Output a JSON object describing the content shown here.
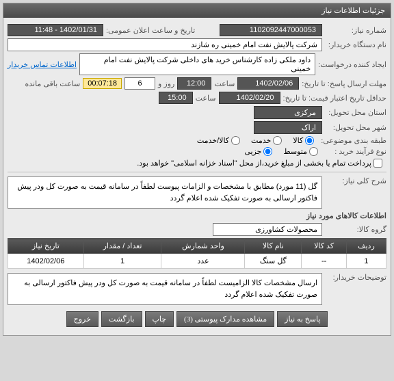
{
  "header": {
    "title": "جزئیات اطلاعات نیاز"
  },
  "info": {
    "need_no_label": "شماره نیاز:",
    "need_no": "1102092447000053",
    "announce_label": "تاریخ و ساعت اعلان عمومی:",
    "announce": "1402/01/31 - 11:48",
    "org_label": "نام دستگاه خریدار:",
    "org": "شرکت پالایش نفت امام خمینی  ره  شازند",
    "creator_label": "ایجاد کننده درخواست:",
    "creator": "داود  ملکی زاده کارشناس خرید های داخلی  شرکت پالایش نفت امام خمینی",
    "contact": "اطلاعات تماس خریدار",
    "deadline_label": "مهلت ارسال پاسخ: تا تاریخ:",
    "deadline_date": "1402/02/06",
    "hour_lbl": "ساعت",
    "deadline_hour": "12:00",
    "day_lbl": "روز و",
    "days": "6",
    "countdown": "00:07:18",
    "remain": "ساعت باقی مانده",
    "valid_label": "حداقل تاریخ اعتبار قیمت: تا تاریخ:",
    "valid_date": "1402/02/20",
    "valid_hour": "15:00",
    "province_label": "استان محل تحویل:",
    "province": "مرکزی",
    "city_label": "شهر محل تحویل:",
    "city": "اراک",
    "topic_label": "طبقه بندی موضوعی:",
    "t_goods": "کالا",
    "t_service": "خدمت",
    "t_goodsservice": "کالا/خدمت",
    "proc_label": "نوع فرآیند خرید :",
    "p_medium": "متوسط",
    "p_partial": "جزیی",
    "p_note": "پرداخت تمام یا بخشی از مبلغ خرید،از محل \"اسناد خزانه اسلامی\" خواهد بود."
  },
  "desc": {
    "label": "شرح کلی نیاز:",
    "text": "گل (11 مورد) مطابق با مشخصات و الزامات پیوست لطفاً در سامانه قیمت به صورت کل ودر پیش فاکتور ارسالی به صورت تفکیک شده اعلام گردد"
  },
  "goods_header": "اطلاعات کالاهای مورد نیاز",
  "group_label": "گروه کالا:",
  "group": "محصولات کشاورزی",
  "table": {
    "cols": [
      "ردیف",
      "کد کالا",
      "نام کالا",
      "واحد شمارش",
      "تعداد / مقدار",
      "تاریخ نیاز"
    ],
    "row": {
      "idx": "1",
      "code": "--",
      "name": "گل سنگ",
      "unit": "عدد",
      "qty": "1",
      "date": "1402/02/06"
    }
  },
  "buyer_note": {
    "label": "توضیحات خریدار:",
    "text": "ارسال مشخصات کالا الزامیست لطفاً در سامانه قیمت به صورت کل ودر پیش فاکتور ارسالی به صورت تفکیک شده اعلام گردد"
  },
  "buttons": {
    "respond": "پاسخ به نیاز",
    "attach": "مشاهده مدارک پیوستی (3)",
    "print": "چاپ",
    "back": "بازگشت",
    "exit": "خروج"
  }
}
